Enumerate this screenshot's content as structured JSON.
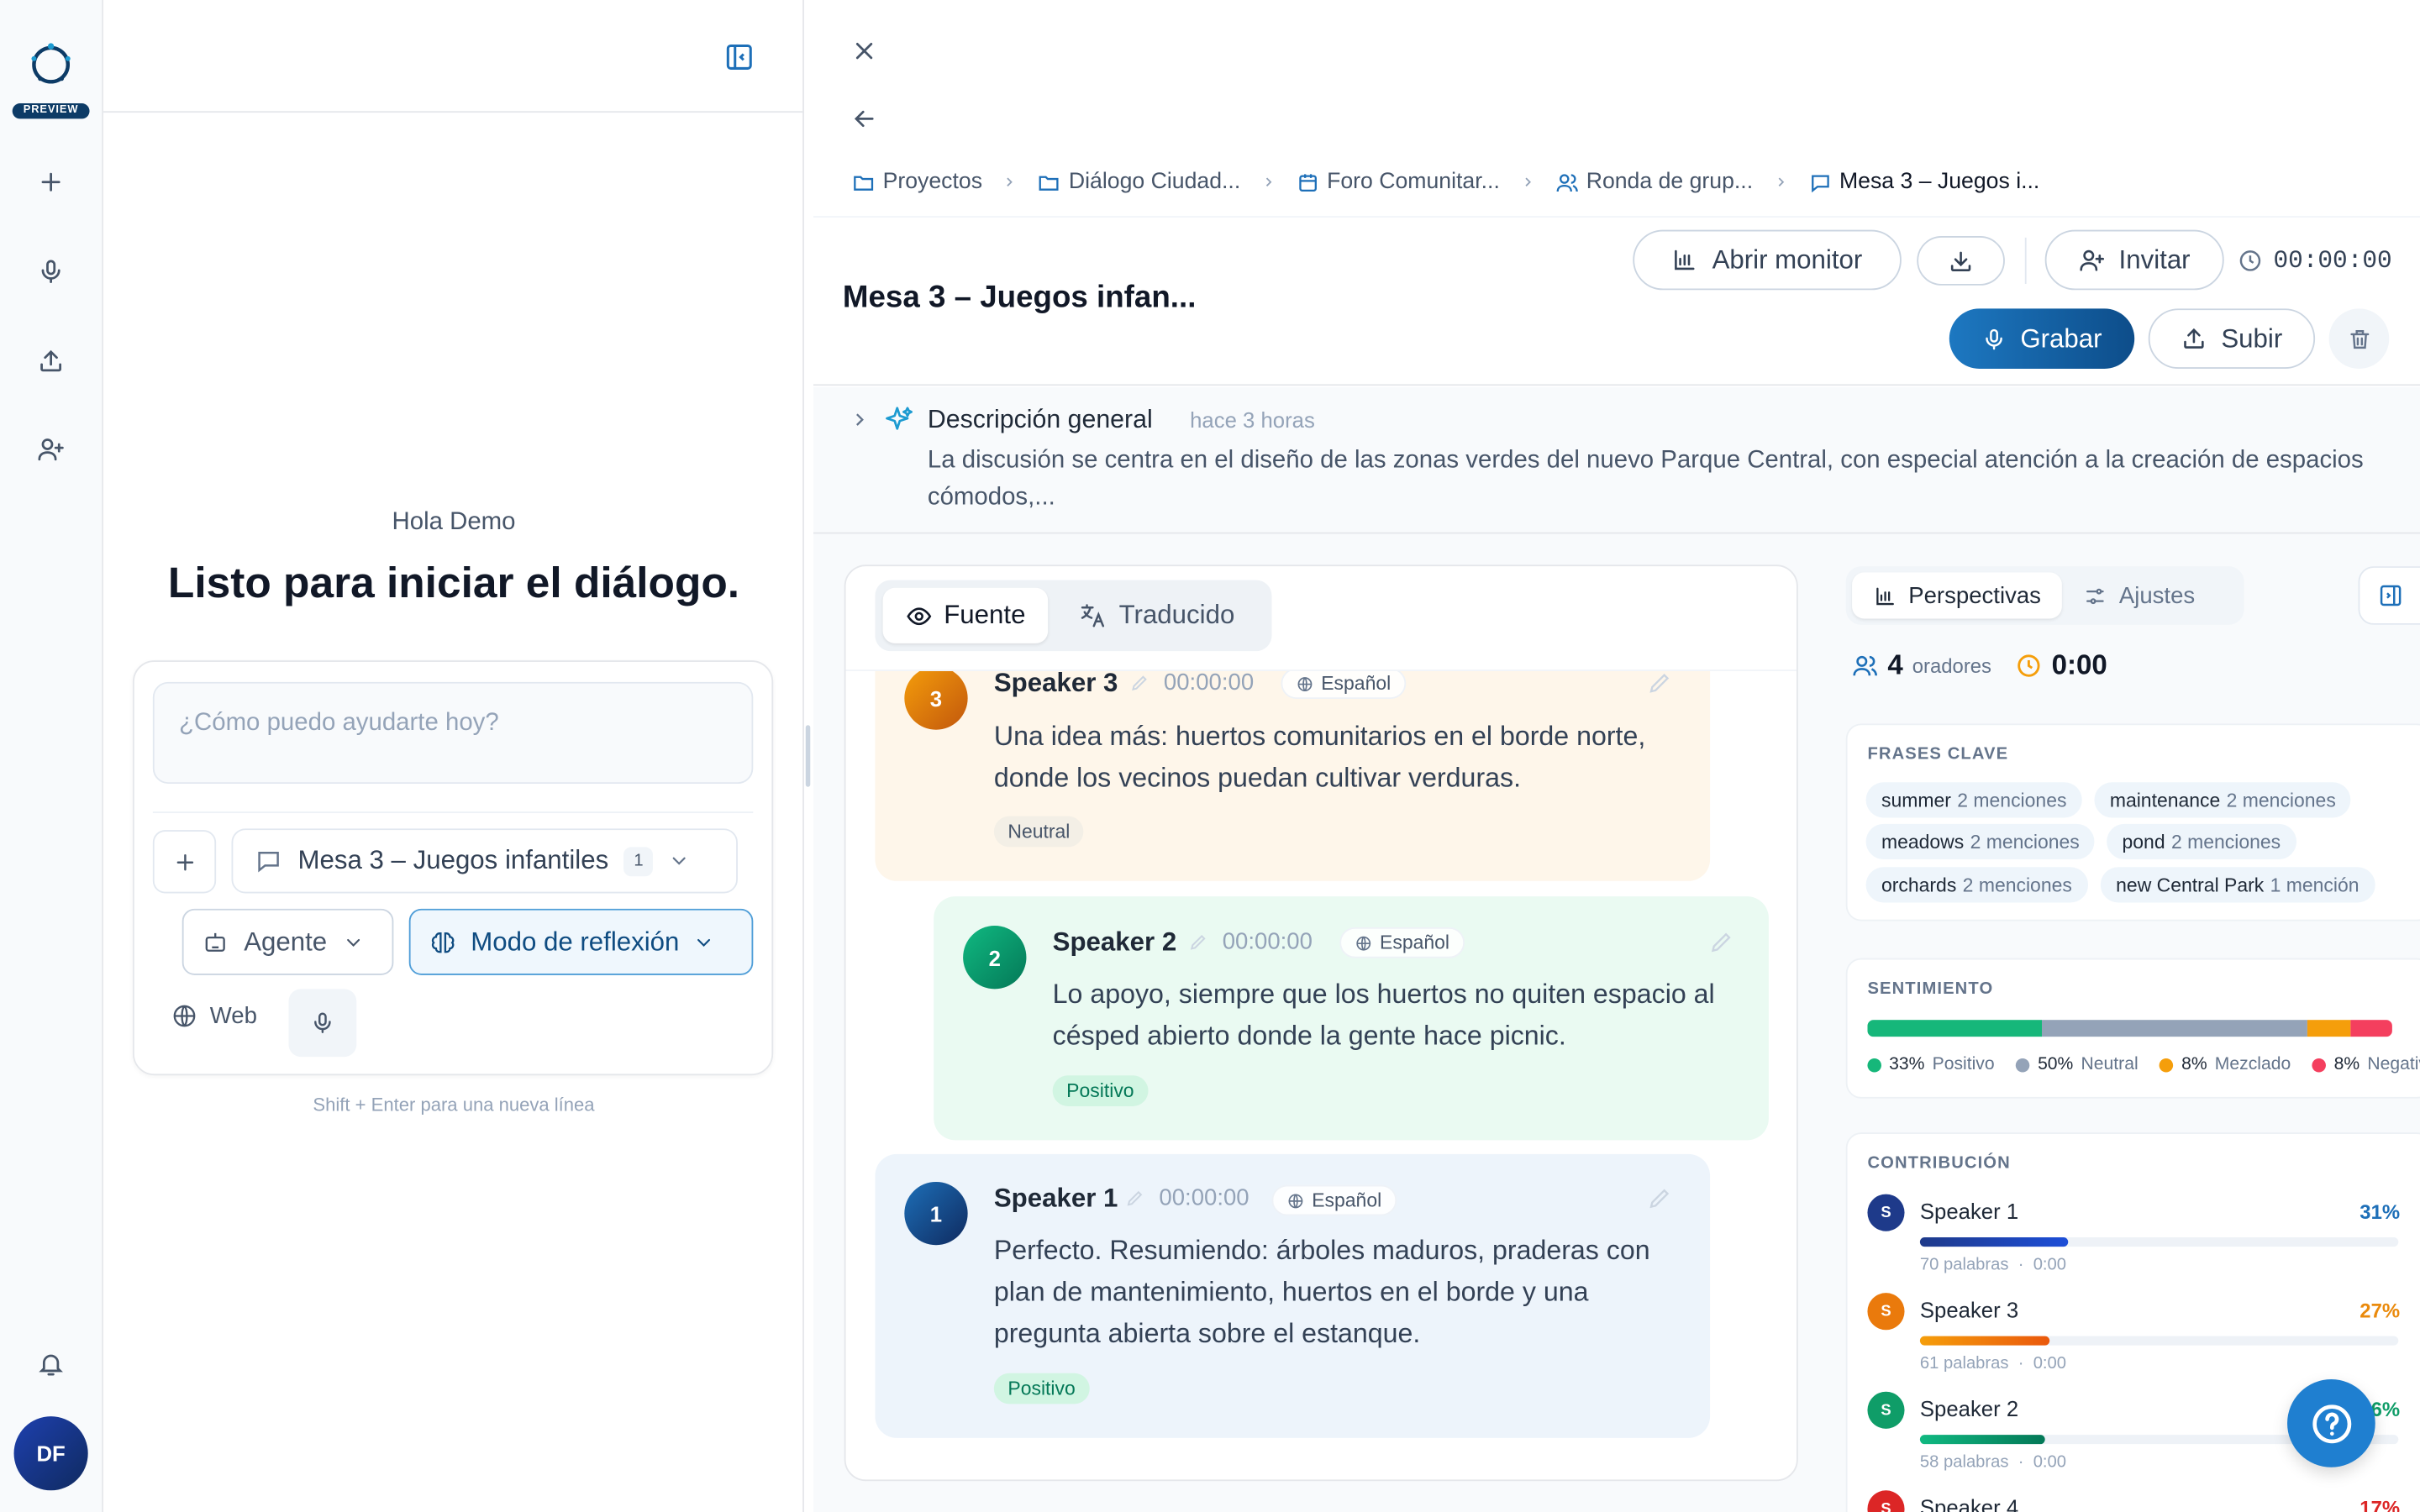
{
  "rail": {
    "preview_badge": "PREVIEW",
    "avatar_initials": "DF",
    "icons": [
      "plus-icon",
      "microphone-icon",
      "upload-icon",
      "add-user-icon",
      "bell-icon"
    ]
  },
  "chat": {
    "greeting": "Hola Demo",
    "headline": "Listo para iniciar el diálogo.",
    "prompt_placeholder": "¿Cómo puedo ayudarte hoy?",
    "conversation_chip": "Mesa 3 – Juegos infantiles",
    "conversation_count": "1",
    "agent_label": "Agente",
    "mode_label": "Modo de reflexión",
    "web_label": "Web",
    "hint": "Shift + Enter para una nueva línea"
  },
  "breadcrumbs": [
    {
      "label": "Proyectos",
      "icon": "folder-icon"
    },
    {
      "label": "Diálogo Ciudad...",
      "icon": "folder-icon"
    },
    {
      "label": "Foro Comunitar...",
      "icon": "calendar-icon"
    },
    {
      "label": "Ronda de grup...",
      "icon": "users-icon"
    },
    {
      "label": "Mesa 3 – Juegos i...",
      "icon": "chat-icon"
    }
  ],
  "header": {
    "title": "Mesa 3 – Juegos infan...",
    "monitor_label": "Abrir monitor",
    "invite_label": "Invitar",
    "timer": "00:00:00",
    "record_label": "Grabar",
    "upload_label": "Subir"
  },
  "overview": {
    "title": "Descripción general",
    "time": "hace 3 horas",
    "text": "La discusión se centra en el diseño de las zonas verdes del nuevo Parque Central, con especial atención a la creación de espacios cómodos,..."
  },
  "transcript": {
    "tab_source": "Fuente",
    "tab_translated": "Traducido",
    "messages": [
      {
        "num": "3",
        "speaker": "Speaker 3",
        "time": "00:00:00",
        "lang": "Español",
        "text": "Una idea más: huertos comunitarios en el borde norte, donde los vecinos puedan cultivar verduras.",
        "sentiment": "Neutral"
      },
      {
        "num": "2",
        "speaker": "Speaker 2",
        "time": "00:00:00",
        "lang": "Español",
        "text": "Lo apoyo, siempre que los huertos no quiten espacio al césped abierto donde la gente hace picnic.",
        "sentiment": "Positivo"
      },
      {
        "num": "1",
        "speaker": "Speaker 1",
        "time": "00:00:00",
        "lang": "Español",
        "text": "Perfecto. Resumiendo: árboles maduros, praderas con plan de mantenimiento, huertos en el borde y una pregunta abierta sobre el estanque.",
        "sentiment": "Positivo"
      }
    ]
  },
  "insights": {
    "tab_perspectives": "Perspectivas",
    "tab_settings": "Ajustes",
    "speakers_count": "4",
    "speakers_label": "oradores",
    "duration": "0:00",
    "key_phrases_title": "FRASES CLAVE",
    "key_phrases": [
      {
        "term": "summer",
        "mentions": "2 menciones"
      },
      {
        "term": "maintenance",
        "mentions": "2 menciones"
      },
      {
        "term": "meadows",
        "mentions": "2 menciones"
      },
      {
        "term": "pond",
        "mentions": "2 menciones"
      },
      {
        "term": "orchards",
        "mentions": "2 menciones"
      },
      {
        "term": "new Central Park",
        "mentions": "1 mención"
      }
    ],
    "sentiment_title": "SENTIMIENTO",
    "sentiment": [
      {
        "pct": "33%",
        "label": "Positivo",
        "value": 33,
        "color": "#16b77a"
      },
      {
        "pct": "50%",
        "label": "Neutral",
        "value": 50,
        "color": "#94a3b8"
      },
      {
        "pct": "8%",
        "label": "Mezclado",
        "value": 8,
        "color": "#f59e0b"
      },
      {
        "pct": "8%",
        "label": "Negativo",
        "value": 8,
        "color": "#f43f5e"
      }
    ],
    "contribution_title": "CONTRIBUCIÓN",
    "contributions": [
      {
        "initial": "S",
        "name": "Speaker 1",
        "pct": "31%",
        "value": 31,
        "words": "70 palabras",
        "time": "0:00",
        "color": "#1e3a8a",
        "pct_color": "#1d6fb8"
      },
      {
        "initial": "S",
        "name": "Speaker 3",
        "pct": "27%",
        "value": 27,
        "words": "61 palabras",
        "time": "0:00",
        "color": "#ea7a0c",
        "pct_color": "#ea8a0c"
      },
      {
        "initial": "S",
        "name": "Speaker 2",
        "pct": "26%",
        "value": 26,
        "words": "58 palabras",
        "time": "0:00",
        "color": "#0f9d68",
        "pct_color": "#0f9d68"
      },
      {
        "initial": "S",
        "name": "Speaker 4",
        "pct": "17%",
        "value": 17,
        "words": "",
        "time": "",
        "color": "#dc2626",
        "pct_color": "#dc2626"
      }
    ]
  }
}
